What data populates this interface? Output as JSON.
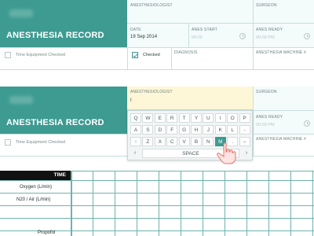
{
  "panel1": {
    "title": "ANESTHESIA RECORD",
    "anesthesiologist_label": "ANESTHESIOLOGIST",
    "surgeon_label": "SURGEON",
    "date_label": "DATE",
    "date_value": "19 Sep 2014",
    "anes_start_label": "ANES START",
    "anes_start_placeholder": "00:00",
    "anes_ready_label": "ANES READY",
    "anes_ready_placeholder": "00:00 PM",
    "time_equipment_checked": "Time Equipment Checked",
    "checked_label": "Checked",
    "diagnosis_label": "DIAGNOSIS",
    "machine_label": "ANESTHESIA MACHINE #"
  },
  "panel2": {
    "title": "ANESTHESIA RECORD",
    "anesthesiologist_label": "ANESTHESIOLOGIST",
    "anesthesiologist_value": "I",
    "surgeon_label": "SURGEON",
    "anes_ready_label": "ANES READY",
    "anes_ready_placeholder": "00:00 PM",
    "time_equipment_checked": "Time Equipment Checked",
    "machine_label": "ANESTHESIA MACHINE #"
  },
  "keyboard": {
    "row1": [
      "Q",
      "W",
      "E",
      "R",
      "T",
      "Y",
      "U",
      "I",
      "O",
      "P"
    ],
    "row2": [
      "A",
      "S",
      "D",
      "F",
      "G",
      "H",
      "J",
      "K",
      "L",
      "-"
    ],
    "row3": [
      "↑",
      "Z",
      "X",
      "C",
      "V",
      "B",
      "N",
      "M",
      ".",
      "–"
    ],
    "highlighted_key": "M",
    "space_label": "SPACE",
    "left_arrow": "‹",
    "right_arrow": "›"
  },
  "table": {
    "time_header": "TIME",
    "rows": [
      "Oxygen (L/min)",
      "N20 / Air (L/min)",
      "Propofol"
    ]
  },
  "colors": {
    "accent": "#3d9b91",
    "highlight_field": "#fdf7d7"
  }
}
